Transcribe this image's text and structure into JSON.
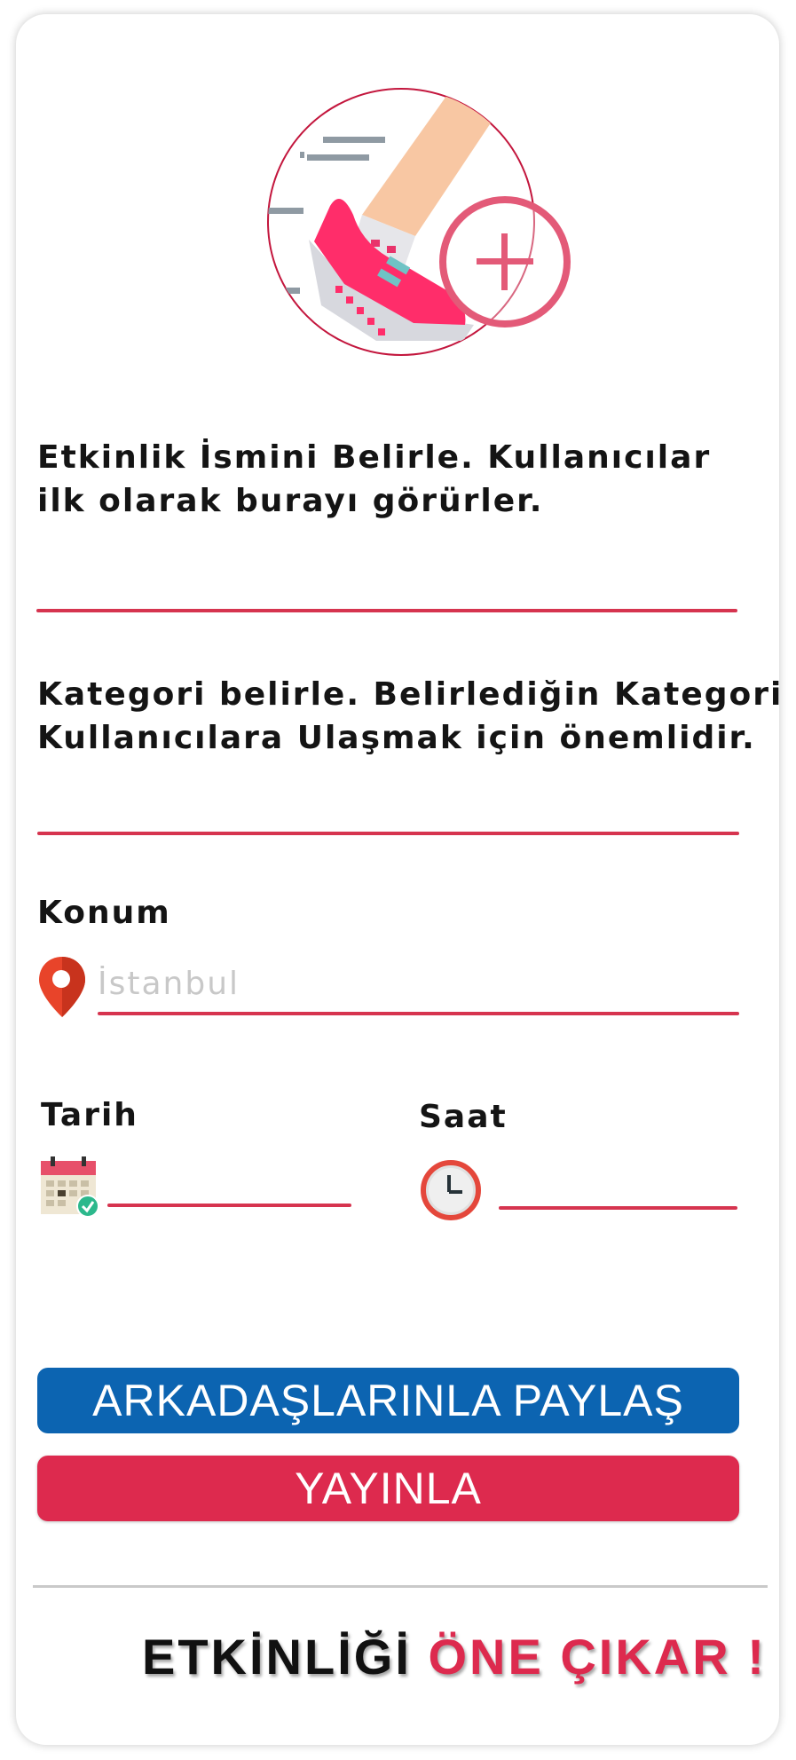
{
  "event_form": {
    "name_label": "Etkinlik İsmini Belirle. Kullanıcılar\nilk olarak burayı görürler.",
    "name_value": "",
    "category_label": "Kategori belirle. Belirlediğin Kategori\nKullanıcılara Ulaşmak için önemlidir.",
    "category_value": "",
    "location_label": "Konum",
    "location_placeholder": "İstanbul",
    "date_label": "Tarih",
    "date_value": "",
    "time_label": "Saat",
    "time_value": ""
  },
  "actions": {
    "share_label": "ARKADAŞLARINLA PAYLAŞ",
    "publish_label": "YAYINLA"
  },
  "promo": {
    "part1": "ETKİNLİĞİ",
    "part2": "ÖNE ÇIKAR !"
  },
  "icons": {
    "hero": "running-shoe-add-icon",
    "location": "location-pin-icon",
    "date": "calendar-icon",
    "time": "clock-icon"
  },
  "colors": {
    "accent": "#dd2a4e",
    "share_button": "#0c64b1",
    "underline": "#d6344f"
  }
}
